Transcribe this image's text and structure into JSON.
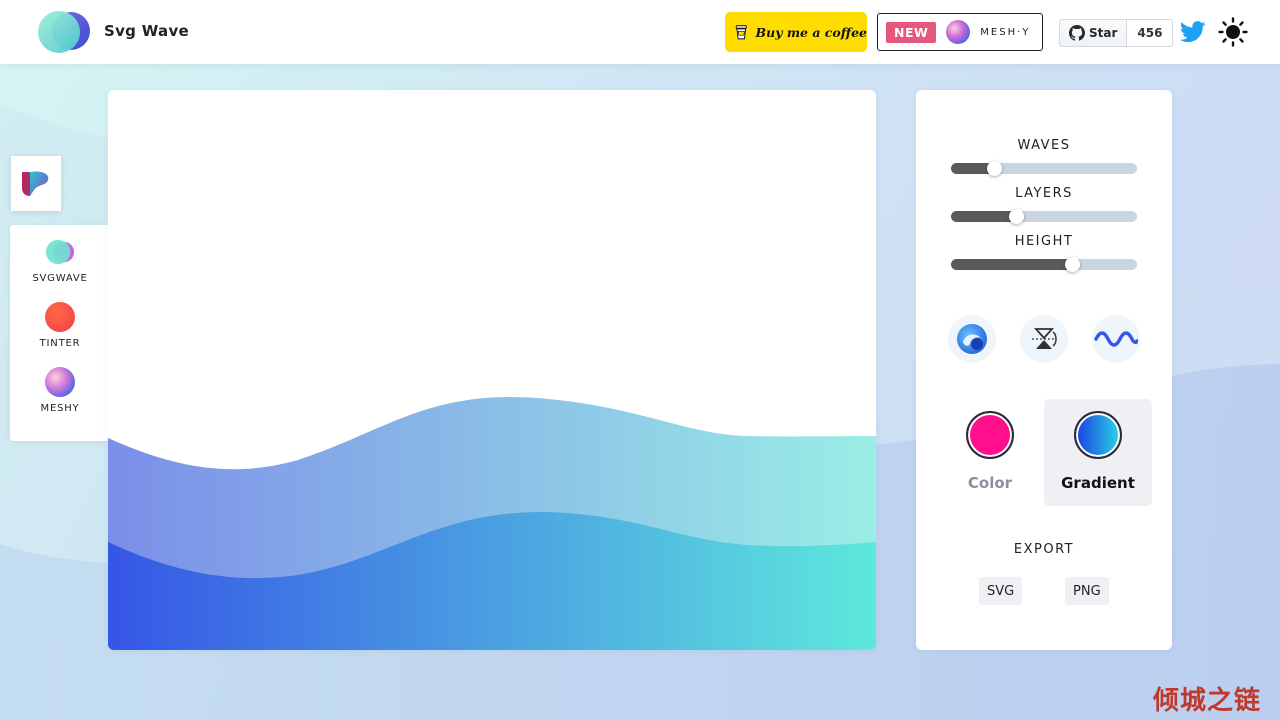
{
  "app": {
    "brand": "Svg Wave"
  },
  "header": {
    "coffee_label": "Buy me a coffee",
    "new_badge": "NEW",
    "meshy_word": "MESH·Y",
    "star_label": "Star",
    "star_count": "456"
  },
  "side_nav": {
    "items": [
      {
        "label": "SVGWAVE",
        "icon": "svgwave-icon"
      },
      {
        "label": "TINTER",
        "icon": "tinter-icon"
      },
      {
        "label": "MESHY",
        "icon": "meshy-icon"
      }
    ]
  },
  "controls": {
    "sliders": [
      {
        "label": "WAVES",
        "value": 0.23
      },
      {
        "label": "LAYERS",
        "value": 0.35
      },
      {
        "label": "HEIGHT",
        "value": 0.65
      }
    ],
    "tools": [
      "randomize-icon",
      "flip-icon",
      "wave-style-icon"
    ],
    "modes": [
      {
        "label": "Color",
        "active": false,
        "color": "#ff0f8c"
      },
      {
        "label": "Gradient",
        "active": true,
        "colors": [
          "#1c3fe0",
          "#2bd4e8"
        ]
      }
    ],
    "export_label": "EXPORT",
    "export_buttons": [
      "SVG",
      "PNG"
    ]
  },
  "colors": {
    "wave_start": "#3f5fe6",
    "wave_end": "#5ee8e0",
    "accent_coffee": "#ffdd00",
    "accent_new": "#e5577d",
    "twitter": "#1da1f2"
  },
  "watermark": "倾城之链"
}
